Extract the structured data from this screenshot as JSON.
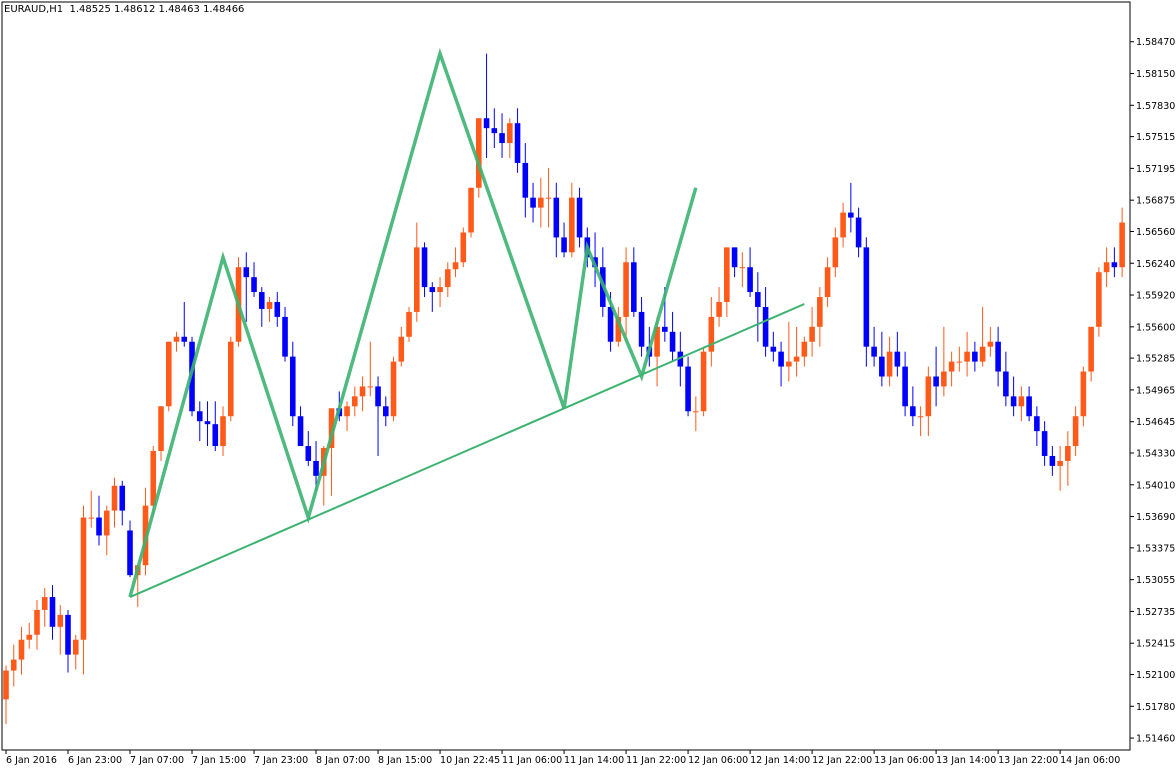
{
  "header": {
    "symbol": "EURAUD,H1",
    "ohlc": "1.48525 1.48612 1.48463 1.48466"
  },
  "colors": {
    "background": "#ffffff",
    "frame": "#000000",
    "bull": "#ff5a1a",
    "bear": "#0000ff",
    "zigzag": "#3cb371",
    "trendline": "#3cb371",
    "text": "#000000"
  },
  "chart_data": {
    "type": "candlestick",
    "grid": false,
    "ylim": [
      1.5134,
      1.5887
    ],
    "y_ticks": [
      "1.58470",
      "1.58150",
      "1.57830",
      "1.57515",
      "1.57195",
      "1.56875",
      "1.56560",
      "1.56240",
      "1.55920",
      "1.55600",
      "1.55285",
      "1.54965",
      "1.54645",
      "1.54330",
      "1.54010",
      "1.53690",
      "1.53375",
      "1.53055",
      "1.52735",
      "1.52415",
      "1.52100",
      "1.51780",
      "1.51460"
    ],
    "x_tick_labels": [
      "6 Jan 2016",
      "6 Jan 23:00",
      "7 Jan 07:00",
      "7 Jan 15:00",
      "7 Jan 23:00",
      "8 Jan 07:00",
      "8 Jan 15:00",
      "10 Jan 22:45",
      "11 Jan 06:00",
      "11 Jan 14:00",
      "11 Jan 22:00",
      "12 Jan 06:00",
      "12 Jan 14:00",
      "12 Jan 22:00",
      "13 Jan 06:00",
      "13 Jan 14:00",
      "13 Jan 22:00",
      "14 Jan 06:00"
    ],
    "x_tick_index": [
      0,
      8,
      16,
      24,
      32,
      40,
      48,
      56,
      64,
      72,
      80,
      88,
      96,
      104,
      112,
      120,
      128,
      136
    ],
    "candles": [
      [
        1.5185,
        1.5219,
        1.516,
        1.5214
      ],
      [
        1.5214,
        1.524,
        1.5198,
        1.5225
      ],
      [
        1.5225,
        1.5258,
        1.521,
        1.5245
      ],
      [
        1.5245,
        1.5262,
        1.5236,
        1.525
      ],
      [
        1.525,
        1.5285,
        1.5235,
        1.5275
      ],
      [
        1.5275,
        1.5297,
        1.5258,
        1.5288
      ],
      [
        1.5288,
        1.53,
        1.5245,
        1.5258
      ],
      [
        1.5258,
        1.528,
        1.523,
        1.527
      ],
      [
        1.527,
        1.5275,
        1.5212,
        1.523
      ],
      [
        1.523,
        1.525,
        1.5215,
        1.5245
      ],
      [
        1.5245,
        1.538,
        1.521,
        1.5368
      ],
      [
        1.5368,
        1.5395,
        1.5358,
        1.5368
      ],
      [
        1.5368,
        1.539,
        1.534,
        1.535
      ],
      [
        1.535,
        1.538,
        1.533,
        1.5375
      ],
      [
        1.5375,
        1.5408,
        1.5358,
        1.54
      ],
      [
        1.54,
        1.5405,
        1.536,
        1.5375
      ],
      [
        1.5355,
        1.5365,
        1.5308,
        1.531
      ],
      [
        1.531,
        1.532,
        1.5278,
        1.532
      ],
      [
        1.532,
        1.5398,
        1.531,
        1.538
      ],
      [
        1.538,
        1.544,
        1.537,
        1.5435
      ],
      [
        1.5435,
        1.548,
        1.5425,
        1.548
      ],
      [
        1.548,
        1.5545,
        1.5475,
        1.5545
      ],
      [
        1.5545,
        1.5555,
        1.5535,
        1.555
      ],
      [
        1.555,
        1.5585,
        1.554,
        1.5545
      ],
      [
        1.5545,
        1.555,
        1.547,
        1.5475
      ],
      [
        1.5475,
        1.5485,
        1.5445,
        1.5465
      ],
      [
        1.5465,
        1.5485,
        1.544,
        1.5462
      ],
      [
        1.5462,
        1.5485,
        1.5435,
        1.544
      ],
      [
        1.544,
        1.548,
        1.543,
        1.547
      ],
      [
        1.547,
        1.555,
        1.5465,
        1.5545
      ],
      [
        1.5545,
        1.563,
        1.554,
        1.562
      ],
      [
        1.562,
        1.5635,
        1.5565,
        1.561
      ],
      [
        1.561,
        1.5625,
        1.559,
        1.5595
      ],
      [
        1.5595,
        1.56,
        1.556,
        1.5578
      ],
      [
        1.5578,
        1.559,
        1.5565,
        1.5585
      ],
      [
        1.5585,
        1.5595,
        1.556,
        1.557
      ],
      [
        1.557,
        1.558,
        1.5525,
        1.553
      ],
      [
        1.553,
        1.5545,
        1.546,
        1.547
      ],
      [
        1.547,
        1.548,
        1.545,
        1.544
      ],
      [
        1.544,
        1.5455,
        1.542,
        1.5425
      ],
      [
        1.5425,
        1.5445,
        1.5395,
        1.541
      ],
      [
        1.541,
        1.544,
        1.538,
        1.5438
      ],
      [
        1.5438,
        1.5475,
        1.539,
        1.5478
      ],
      [
        1.5478,
        1.5495,
        1.5465,
        1.547
      ],
      [
        1.547,
        1.5485,
        1.5455,
        1.548
      ],
      [
        1.548,
        1.55,
        1.547,
        1.549
      ],
      [
        1.549,
        1.551,
        1.5475,
        1.55
      ],
      [
        1.55,
        1.5545,
        1.549,
        1.55
      ],
      [
        1.55,
        1.551,
        1.543,
        1.548
      ],
      [
        1.548,
        1.549,
        1.546,
        1.547
      ],
      [
        1.547,
        1.553,
        1.5465,
        1.5525
      ],
      [
        1.5525,
        1.556,
        1.552,
        1.555
      ],
      [
        1.555,
        1.558,
        1.5545,
        1.5575
      ],
      [
        1.5575,
        1.5665,
        1.5565,
        1.564
      ],
      [
        1.564,
        1.5645,
        1.559,
        1.56
      ],
      [
        1.56,
        1.5605,
        1.5575,
        1.5595
      ],
      [
        1.5595,
        1.561,
        1.558,
        1.56
      ],
      [
        1.56,
        1.5625,
        1.559,
        1.5618
      ],
      [
        1.5618,
        1.564,
        1.561,
        1.5625
      ],
      [
        1.5625,
        1.566,
        1.562,
        1.5655
      ],
      [
        1.5655,
        1.57,
        1.565,
        1.57
      ],
      [
        1.57,
        1.577,
        1.569,
        1.577
      ],
      [
        1.577,
        1.5835,
        1.573,
        1.576
      ],
      [
        1.576,
        1.578,
        1.574,
        1.5755
      ],
      [
        1.5755,
        1.5775,
        1.573,
        1.5745
      ],
      [
        1.5745,
        1.577,
        1.573,
        1.5765
      ],
      [
        1.5765,
        1.578,
        1.5715,
        1.5725
      ],
      [
        1.5725,
        1.5745,
        1.567,
        1.569
      ],
      [
        1.569,
        1.5705,
        1.5665,
        1.568
      ],
      [
        1.568,
        1.571,
        1.566,
        1.569
      ],
      [
        1.569,
        1.572,
        1.566,
        1.569
      ],
      [
        1.569,
        1.5705,
        1.563,
        1.565
      ],
      [
        1.565,
        1.5665,
        1.563,
        1.5635
      ],
      [
        1.5635,
        1.5705,
        1.563,
        1.569
      ],
      [
        1.569,
        1.57,
        1.564,
        1.565
      ],
      [
        1.565,
        1.566,
        1.562,
        1.563
      ],
      [
        1.563,
        1.5655,
        1.56,
        1.562
      ],
      [
        1.562,
        1.564,
        1.557,
        1.558
      ],
      [
        1.558,
        1.5595,
        1.5535,
        1.5545
      ],
      [
        1.5545,
        1.558,
        1.554,
        1.557
      ],
      [
        1.557,
        1.564,
        1.5545,
        1.5625
      ],
      [
        1.5625,
        1.564,
        1.557,
        1.5575
      ],
      [
        1.5575,
        1.559,
        1.553,
        1.554
      ],
      [
        1.554,
        1.556,
        1.552,
        1.553
      ],
      [
        1.553,
        1.557,
        1.55,
        1.556
      ],
      [
        1.556,
        1.56,
        1.5545,
        1.5555
      ],
      [
        1.5555,
        1.5575,
        1.5525,
        1.5535
      ],
      [
        1.5535,
        1.5555,
        1.55,
        1.552
      ],
      [
        1.552,
        1.553,
        1.547,
        1.5475
      ],
      [
        1.5475,
        1.549,
        1.5455,
        1.5475
      ],
      [
        1.5475,
        1.554,
        1.547,
        1.5535
      ],
      [
        1.5535,
        1.559,
        1.552,
        1.557
      ],
      [
        1.557,
        1.56,
        1.556,
        1.5585
      ],
      [
        1.5585,
        1.563,
        1.557,
        1.564
      ],
      [
        1.564,
        1.564,
        1.561,
        1.562
      ],
      [
        1.562,
        1.5635,
        1.56,
        1.562
      ],
      [
        1.562,
        1.564,
        1.559,
        1.5595
      ],
      [
        1.5595,
        1.5615,
        1.5545,
        1.558
      ],
      [
        1.558,
        1.56,
        1.553,
        1.554
      ],
      [
        1.554,
        1.5555,
        1.5525,
        1.5535
      ],
      [
        1.5535,
        1.5545,
        1.55,
        1.552
      ],
      [
        1.552,
        1.5565,
        1.5505,
        1.5525
      ],
      [
        1.5525,
        1.556,
        1.551,
        1.553
      ],
      [
        1.553,
        1.555,
        1.552,
        1.5545
      ],
      [
        1.5545,
        1.558,
        1.553,
        1.556
      ],
      [
        1.556,
        1.56,
        1.554,
        1.559
      ],
      [
        1.559,
        1.563,
        1.558,
        1.562
      ],
      [
        1.562,
        1.566,
        1.561,
        1.565
      ],
      [
        1.565,
        1.5685,
        1.564,
        1.5675
      ],
      [
        1.5675,
        1.5705,
        1.5655,
        1.567
      ],
      [
        1.567,
        1.568,
        1.563,
        1.564
      ],
      [
        1.564,
        1.565,
        1.552,
        1.554
      ],
      [
        1.554,
        1.556,
        1.552,
        1.553
      ],
      [
        1.553,
        1.5555,
        1.55,
        1.551
      ],
      [
        1.551,
        1.555,
        1.55,
        1.5535
      ],
      [
        1.5535,
        1.5555,
        1.551,
        1.552
      ],
      [
        1.552,
        1.5535,
        1.547,
        1.548
      ],
      [
        1.548,
        1.55,
        1.546,
        1.547
      ],
      [
        1.547,
        1.548,
        1.545,
        1.547
      ],
      [
        1.547,
        1.552,
        1.545,
        1.551
      ],
      [
        1.551,
        1.554,
        1.548,
        1.55
      ],
      [
        1.55,
        1.556,
        1.549,
        1.5515
      ],
      [
        1.5515,
        1.5535,
        1.55,
        1.5525
      ],
      [
        1.5525,
        1.554,
        1.5515,
        1.5525
      ],
      [
        1.5525,
        1.5555,
        1.551,
        1.5535
      ],
      [
        1.5535,
        1.5545,
        1.5515,
        1.5525
      ],
      [
        1.5525,
        1.558,
        1.552,
        1.554
      ],
      [
        1.554,
        1.556,
        1.553,
        1.5545
      ],
      [
        1.5545,
        1.556,
        1.55,
        1.5515
      ],
      [
        1.5515,
        1.5535,
        1.548,
        1.549
      ],
      [
        1.549,
        1.551,
        1.547,
        1.548
      ],
      [
        1.548,
        1.55,
        1.5465,
        1.549
      ],
      [
        1.549,
        1.55,
        1.5465,
        1.547
      ],
      [
        1.547,
        1.548,
        1.544,
        1.5455
      ],
      [
        1.5455,
        1.5465,
        1.542,
        1.543
      ],
      [
        1.543,
        1.544,
        1.541,
        1.542
      ],
      [
        1.542,
        1.544,
        1.5395,
        1.5425
      ],
      [
        1.5425,
        1.5455,
        1.54,
        1.544
      ],
      [
        1.544,
        1.548,
        1.543,
        1.547
      ],
      [
        1.547,
        1.552,
        1.546,
        1.5515
      ],
      [
        1.5515,
        1.556,
        1.5505,
        1.556
      ],
      [
        1.556,
        1.562,
        1.555,
        1.5615
      ],
      [
        1.5615,
        1.564,
        1.56,
        1.5625
      ],
      [
        1.5625,
        1.564,
        1.561,
        1.562
      ],
      [
        1.562,
        1.568,
        1.561,
        1.5665
      ]
    ],
    "zigzag_index": [
      16,
      28,
      39,
      56,
      72,
      75,
      82,
      89
    ],
    "zigzag_price": [
      1.5288,
      1.563,
      1.5368,
      1.5835,
      1.5478,
      1.564,
      1.551,
      1.57
    ],
    "trendline": {
      "index": [
        16,
        103
      ],
      "price": [
        1.5288,
        1.5583
      ]
    }
  }
}
